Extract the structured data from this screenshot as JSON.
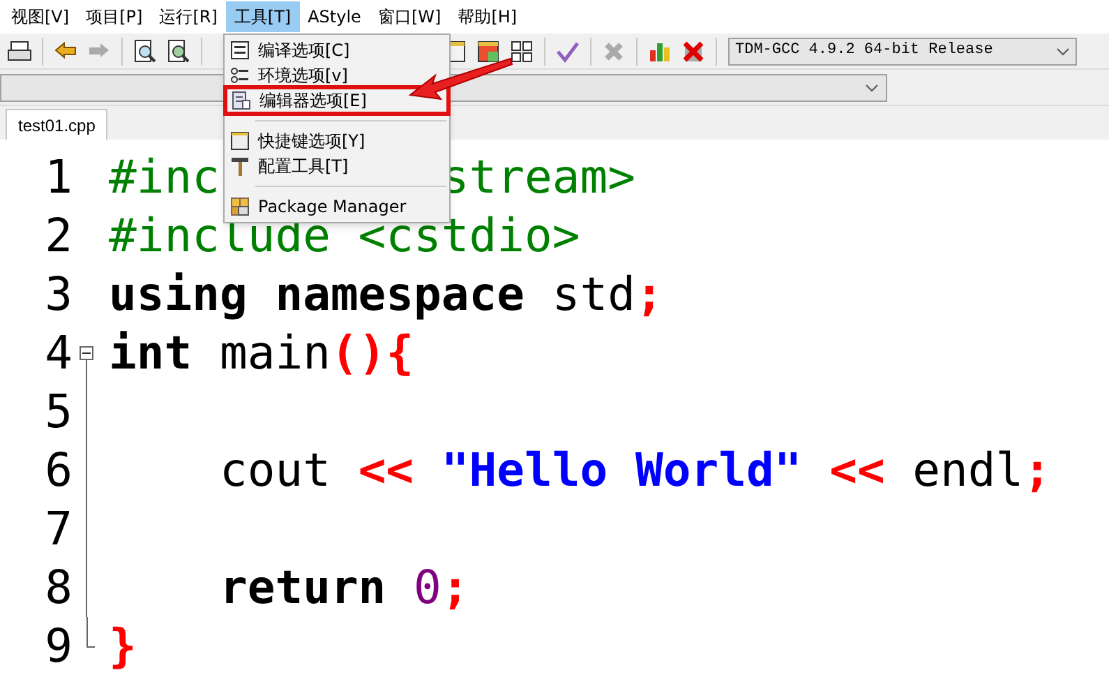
{
  "menu_bar": [
    {
      "label": "视图[V]",
      "selected": false
    },
    {
      "label": "项目[P]",
      "selected": false
    },
    {
      "label": "运行[R]",
      "selected": false
    },
    {
      "label": "工具[T]",
      "selected": true
    },
    {
      "label": "AStyle",
      "selected": false
    },
    {
      "label": "窗口[W]",
      "selected": false
    },
    {
      "label": "帮助[H]",
      "selected": false
    }
  ],
  "compiler_select": {
    "value": "TDM-GCC 4.9.2 64-bit Release"
  },
  "tabs": [
    {
      "label": "test01.cpp",
      "selected": true
    }
  ],
  "tools_menu": [
    {
      "kind": "item",
      "label": "编译选项[C]",
      "highlighted": false
    },
    {
      "kind": "item",
      "label": "环境选项[v]",
      "highlighted": false
    },
    {
      "kind": "item",
      "label": "编辑器选项[E]",
      "highlighted": true
    },
    {
      "kind": "separator"
    },
    {
      "kind": "item",
      "label": "快捷键选项[Y]",
      "highlighted": false
    },
    {
      "kind": "item",
      "label": "配置工具[T]",
      "highlighted": false
    },
    {
      "kind": "separator"
    },
    {
      "kind": "item",
      "label": "Package Manager",
      "highlighted": false
    }
  ],
  "editor": {
    "lines": [
      {
        "number": "1",
        "kind": "plain",
        "tokens": [
          {
            "kind": "preprocessor",
            "text": "#inc"
          },
          {
            "kind": "covered"
          },
          {
            "kind": "preprocessor",
            "text": "stream>"
          }
        ]
      },
      {
        "number": "2",
        "kind": "plain",
        "tokens": [
          {
            "kind": "preprocessor",
            "text": "#include <cstdio>"
          }
        ]
      },
      {
        "number": "3",
        "kind": "plain",
        "tokens": [
          {
            "kind": "keyword",
            "text": "using namespace"
          },
          {
            "kind": "plain",
            "text": " std"
          },
          {
            "kind": "symbol",
            "text": ";"
          }
        ]
      },
      {
        "number": "4",
        "kind": "fold_start",
        "tokens": [
          {
            "kind": "keyword",
            "text": "int"
          },
          {
            "kind": "plain",
            "text": " main"
          },
          {
            "kind": "symbol",
            "text": "(){"
          }
        ]
      },
      {
        "number": "5",
        "kind": "fold_body"
      },
      {
        "number": "6",
        "kind": "fold_body",
        "indent": true,
        "tokens": [
          {
            "kind": "plain",
            "text": "cout "
          },
          {
            "kind": "symbol",
            "text": "<< "
          },
          {
            "kind": "string",
            "text": "\"Hello World\""
          },
          {
            "kind": "symbol",
            "text": " <<"
          },
          {
            "kind": "plain",
            "text": " endl"
          },
          {
            "kind": "symbol",
            "text": ";"
          }
        ]
      },
      {
        "number": "7",
        "kind": "fold_body"
      },
      {
        "number": "8",
        "kind": "fold_body",
        "indent": true,
        "tokens": [
          {
            "kind": "keyword",
            "text": "return "
          },
          {
            "kind": "number",
            "text": "0"
          },
          {
            "kind": "symbol",
            "text": ";"
          }
        ]
      },
      {
        "number": "9",
        "kind": "fold_end",
        "tokens": [
          {
            "kind": "symbol",
            "text": "}"
          }
        ]
      }
    ]
  }
}
